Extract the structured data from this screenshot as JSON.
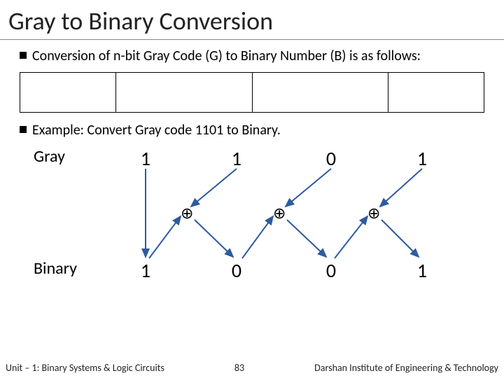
{
  "title": "Gray to Binary Conversion",
  "bullets": {
    "b1": "Conversion of n-bit Gray Code (G) to Binary Number (B) is as follows:",
    "b2": "Example: Convert Gray code 1101 to Binary."
  },
  "diagram": {
    "grayLabel": "Gray",
    "binaryLabel": "Binary",
    "gray": [
      "1",
      "1",
      "0",
      "1"
    ],
    "binary": [
      "1",
      "0",
      "0",
      "1"
    ],
    "xor": "⊕"
  },
  "footer": {
    "left": "Unit – 1: Binary Systems & Logic Circuits",
    "page": "83",
    "right": "Darshan Institute of Engineering & Technology"
  }
}
